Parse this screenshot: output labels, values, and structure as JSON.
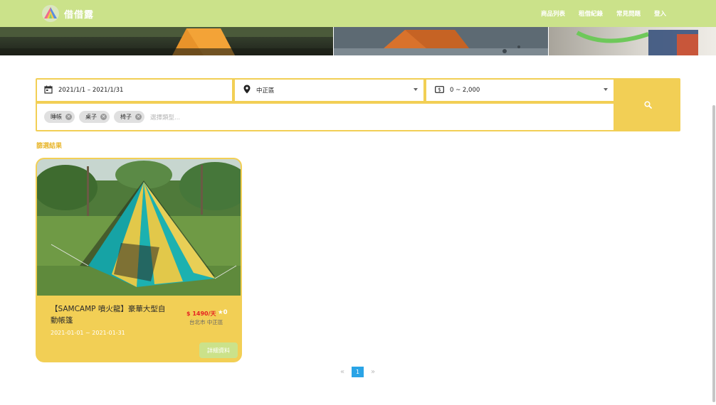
{
  "navbar": {
    "brand": "借借露",
    "links": [
      "商品列表",
      "租借紀錄",
      "常見問題",
      "登入"
    ]
  },
  "search": {
    "date_range": "2021/1/1 – 2021/1/31",
    "area": "中正區",
    "price_range": "0 ~ 2,000",
    "tags": [
      "睡帳",
      "桌子",
      "椅子"
    ],
    "tag_placeholder": "選擇類型..."
  },
  "results": {
    "label": "篩選結果",
    "items": [
      {
        "title": "【SAMCAMP 噴火龍】豪華大型自動帳篷",
        "dates": "2021-01-01 ~ 2021-01-31",
        "price": "$ 1490/天",
        "rating": "★0",
        "location": "台北市 中正區",
        "detail_label": "詳細資料"
      }
    ]
  },
  "pagination": {
    "prev": "«",
    "current": "1",
    "next": "»"
  },
  "colors": {
    "navbar": "#cbe28a",
    "panel": "#f2cf55",
    "price": "#e52222",
    "page_active": "#2aa4e6"
  }
}
